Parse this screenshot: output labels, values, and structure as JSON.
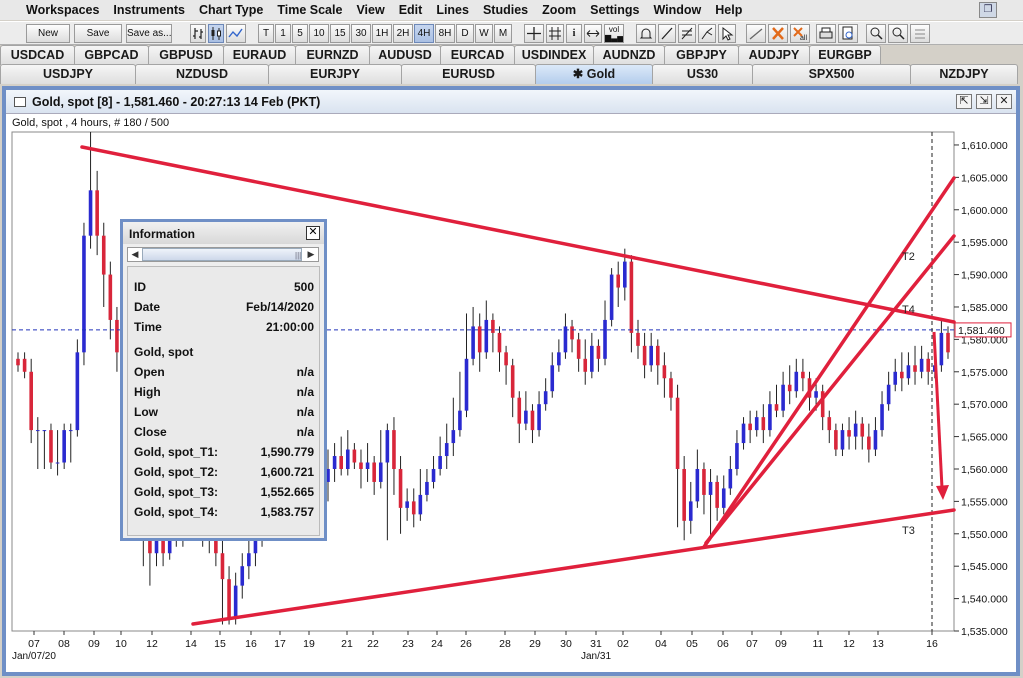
{
  "menu": [
    "Workspaces",
    "Instruments",
    "Chart Type",
    "Time Scale",
    "View",
    "Edit",
    "Lines",
    "Studies",
    "Zoom",
    "Settings",
    "Window",
    "Help"
  ],
  "toolbar": {
    "new_label": "New",
    "save_label": "Save",
    "save_as_label": "Save as...",
    "text_buttons": [
      "T",
      "1",
      "5",
      "10",
      "15",
      "30",
      "1H",
      "2H",
      "4H",
      "8H",
      "D",
      "W",
      "M"
    ],
    "selected_timeframe": "4H",
    "vol_label": "vol",
    "icons": [
      "bar-chart-icon",
      "candlestick-icon",
      "line-chart-icon",
      "crosshair-icon",
      "grid-icon",
      "info-icon",
      "arrows-icon",
      "alarm-bell-icon",
      "trendline-icon",
      "fib-icon",
      "pitchfork-icon",
      "cursor-icon",
      "line-tool-icon",
      "delete-icon",
      "delete-all-icon",
      "print-icon",
      "print-preview-icon",
      "zoom-in-icon",
      "zoom-out-icon",
      "zoom-reset-icon"
    ]
  },
  "tabs_row1": [
    "USDCAD",
    "GBPCAD",
    "GBPUSD",
    "EURAUD",
    "EURNZD",
    "AUDUSD",
    "EURCAD",
    "USDINDEX",
    "AUDNZD",
    "GBPJPY",
    "AUDJPY",
    "EURGBP"
  ],
  "tabs_row2": [
    "USDJPY",
    "NZDUSD",
    "EURJPY",
    "EURUSD",
    "✱ Gold",
    "US30",
    "SPX500",
    "NZDJPY"
  ],
  "active_tab": "✱ Gold",
  "window": {
    "title": "Gold, spot [8] - 1,581.460 - 20:27:13  14 Feb (PKT)",
    "subtitle": "Gold, spot , 4 hours, # 180 / 500",
    "controls": [
      "⇱",
      "⇲",
      "✕"
    ]
  },
  "info_panel": {
    "title": "Information",
    "close": "✕",
    "rows": [
      {
        "label": "ID",
        "value": "500"
      },
      {
        "label": "Date",
        "value": "Feb/14/2020"
      },
      {
        "label": "Time",
        "value": "21:00:00"
      },
      {
        "label": "Gold, spot",
        "value": ""
      },
      {
        "label": "Open",
        "value": "n/a"
      },
      {
        "label": "High",
        "value": "n/a"
      },
      {
        "label": "Low",
        "value": "n/a"
      },
      {
        "label": "Close",
        "value": "n/a"
      },
      {
        "label": "Gold, spot_T1:",
        "value": "1,590.779"
      },
      {
        "label": "Gold, spot_T2:",
        "value": "1,600.721"
      },
      {
        "label": "Gold, spot_T3:",
        "value": "1,552.665"
      },
      {
        "label": "Gold, spot_T4:",
        "value": "1,583.757"
      }
    ]
  },
  "chart_data": {
    "type": "candlestick",
    "symbol": "Gold, spot",
    "timeframe": "4 hours",
    "last_price": 1581.46,
    "last_price_label": "1,581.460",
    "ylim": [
      1535,
      1612
    ],
    "y_ticks": [
      "1,610.000",
      "1,605.000",
      "1,600.000",
      "1,595.000",
      "1,590.000",
      "1,585.000",
      "1,580.000",
      "1,575.000",
      "1,570.000",
      "1,565.000",
      "1,560.000",
      "1,555.000",
      "1,550.000",
      "1,545.000",
      "1,540.000",
      "1,535.000"
    ],
    "y_tick_values": [
      1610,
      1605,
      1600,
      1595,
      1590,
      1585,
      1580,
      1575,
      1570,
      1565,
      1560,
      1555,
      1550,
      1545,
      1540,
      1535
    ],
    "x_ticks": [
      "07",
      "08",
      "09",
      "10",
      "12",
      "14",
      "15",
      "16",
      "17",
      "19",
      "21",
      "22",
      "23",
      "24",
      "26",
      "28",
      "29",
      "30",
      "31",
      "02",
      "04",
      "05",
      "06",
      "07",
      "09",
      "11",
      "12",
      "13",
      "16"
    ],
    "x_start_label": "Jan/07/20",
    "x_mid_label": "Jan/31",
    "trendline_labels": [
      "T2",
      "T4",
      "T3"
    ],
    "colors": {
      "up": "#2a2ad0",
      "down": "#d8263a",
      "trendline": "#e0203c",
      "price_line": "#2233bb"
    },
    "candles": [
      [
        1577,
        1576,
        1578,
        1575
      ],
      [
        1577,
        1575,
        1578,
        1574
      ],
      [
        1575,
        1566,
        1577,
        1564
      ],
      [
        1566,
        1566,
        1568,
        1560
      ],
      [
        1566,
        1566,
        1566,
        1560
      ],
      [
        1566,
        1561,
        1567,
        1560
      ],
      [
        1561,
        1561,
        1566,
        1559
      ],
      [
        1561,
        1566,
        1567,
        1560
      ],
      [
        1566,
        1566,
        1567,
        1561
      ],
      [
        1566,
        1578,
        1580,
        1565
      ],
      [
        1578,
        1596,
        1598,
        1576
      ],
      [
        1596,
        1603,
        1612,
        1594
      ],
      [
        1603,
        1596,
        1606,
        1593
      ],
      [
        1596,
        1590,
        1598,
        1585
      ],
      [
        1590,
        1583,
        1592,
        1580
      ],
      [
        1583,
        1578,
        1585,
        1575
      ],
      [
        1578,
        1570,
        1581,
        1566
      ],
      [
        1570,
        1560,
        1572,
        1556
      ],
      [
        1560,
        1553,
        1563,
        1550
      ],
      [
        1553,
        1549,
        1556,
        1545
      ],
      [
        1549,
        1547,
        1556,
        1542
      ],
      [
        1547,
        1549,
        1554,
        1545
      ],
      [
        1549,
        1547,
        1552,
        1545
      ],
      [
        1547,
        1555,
        1557,
        1546
      ],
      [
        1555,
        1552,
        1557,
        1548
      ],
      [
        1552,
        1551,
        1556,
        1548
      ],
      [
        1551,
        1554,
        1556,
        1549
      ],
      [
        1554,
        1553,
        1556,
        1551
      ],
      [
        1553,
        1551,
        1555,
        1548
      ],
      [
        1551,
        1550,
        1554,
        1547
      ],
      [
        1550,
        1547,
        1552,
        1545
      ],
      [
        1547,
        1543,
        1549,
        1536
      ],
      [
        1543,
        1537,
        1545,
        1536
      ],
      [
        1537,
        1542,
        1544,
        1536
      ],
      [
        1542,
        1545,
        1547,
        1540
      ],
      [
        1545,
        1547,
        1549,
        1543
      ],
      [
        1547,
        1550,
        1552,
        1545
      ],
      [
        1550,
        1552,
        1555,
        1548
      ],
      [
        1552,
        1555,
        1558,
        1550
      ],
      [
        1555,
        1556,
        1560,
        1553
      ],
      [
        1556,
        1554,
        1558,
        1552
      ],
      [
        1554,
        1556,
        1559,
        1551
      ],
      [
        1556,
        1553,
        1558,
        1551
      ],
      [
        1553,
        1555,
        1557,
        1550
      ],
      [
        1555,
        1553,
        1556,
        1549
      ],
      [
        1553,
        1556,
        1558,
        1551
      ],
      [
        1556,
        1558,
        1561,
        1554
      ],
      [
        1558,
        1560,
        1563,
        1555
      ],
      [
        1560,
        1562,
        1564,
        1558
      ],
      [
        1562,
        1560,
        1565,
        1559
      ],
      [
        1560,
        1563,
        1566,
        1559
      ],
      [
        1563,
        1561,
        1564,
        1560
      ],
      [
        1561,
        1560,
        1563,
        1557
      ],
      [
        1560,
        1561,
        1564,
        1558
      ],
      [
        1561,
        1558,
        1562,
        1556
      ],
      [
        1558,
        1561,
        1566,
        1557
      ],
      [
        1561,
        1566,
        1567,
        1549
      ],
      [
        1566,
        1560,
        1568,
        1556
      ],
      [
        1560,
        1554,
        1562,
        1550
      ],
      [
        1554,
        1555,
        1557,
        1552
      ],
      [
        1555,
        1553,
        1557,
        1551
      ],
      [
        1553,
        1556,
        1560,
        1552
      ],
      [
        1556,
        1558,
        1560,
        1555
      ],
      [
        1558,
        1560,
        1562,
        1557
      ],
      [
        1560,
        1562,
        1565,
        1559
      ],
      [
        1562,
        1564,
        1567,
        1560
      ],
      [
        1564,
        1566,
        1571,
        1562
      ],
      [
        1566,
        1569,
        1575,
        1565
      ],
      [
        1569,
        1577,
        1584,
        1568
      ],
      [
        1577,
        1582,
        1585,
        1576
      ],
      [
        1582,
        1578,
        1584,
        1575
      ],
      [
        1578,
        1583,
        1586,
        1577
      ],
      [
        1583,
        1581,
        1584,
        1578
      ],
      [
        1581,
        1578,
        1582,
        1575
      ],
      [
        1578,
        1576,
        1579,
        1573
      ],
      [
        1576,
        1571,
        1577,
        1568
      ],
      [
        1571,
        1567,
        1572,
        1564
      ],
      [
        1567,
        1569,
        1572,
        1566
      ],
      [
        1569,
        1566,
        1570,
        1564
      ],
      [
        1566,
        1570,
        1572,
        1565
      ],
      [
        1570,
        1572,
        1574,
        1569
      ],
      [
        1572,
        1576,
        1578,
        1571
      ],
      [
        1576,
        1578,
        1580,
        1575
      ],
      [
        1578,
        1582,
        1584,
        1577
      ],
      [
        1582,
        1580,
        1583,
        1578
      ],
      [
        1580,
        1577,
        1581,
        1575
      ],
      [
        1577,
        1575,
        1580,
        1573
      ],
      [
        1575,
        1579,
        1581,
        1574
      ],
      [
        1579,
        1577,
        1580,
        1575
      ],
      [
        1577,
        1583,
        1586,
        1576
      ],
      [
        1583,
        1590,
        1591,
        1582
      ],
      [
        1590,
        1588,
        1592,
        1585
      ],
      [
        1588,
        1592,
        1594,
        1586
      ],
      [
        1592,
        1581,
        1593,
        1578
      ],
      [
        1581,
        1579,
        1583,
        1577
      ],
      [
        1579,
        1576,
        1581,
        1574
      ],
      [
        1576,
        1579,
        1581,
        1575
      ],
      [
        1579,
        1576,
        1580,
        1573
      ],
      [
        1576,
        1574,
        1578,
        1571
      ],
      [
        1574,
        1571,
        1575,
        1569
      ],
      [
        1571,
        1560,
        1573,
        1551
      ],
      [
        1560,
        1552,
        1562,
        1549
      ],
      [
        1552,
        1555,
        1558,
        1550
      ],
      [
        1555,
        1560,
        1563,
        1554
      ],
      [
        1560,
        1556,
        1561,
        1553
      ],
      [
        1556,
        1558,
        1560,
        1549
      ],
      [
        1558,
        1554,
        1559,
        1552
      ],
      [
        1554,
        1557,
        1559,
        1553
      ],
      [
        1557,
        1560,
        1562,
        1556
      ],
      [
        1560,
        1564,
        1566,
        1559
      ],
      [
        1564,
        1567,
        1568,
        1563
      ],
      [
        1567,
        1566,
        1569,
        1564
      ],
      [
        1566,
        1568,
        1569,
        1565
      ],
      [
        1568,
        1566,
        1570,
        1564
      ],
      [
        1566,
        1570,
        1572,
        1565
      ],
      [
        1570,
        1569,
        1573,
        1568
      ],
      [
        1569,
        1573,
        1575,
        1568
      ],
      [
        1573,
        1572,
        1576,
        1570
      ],
      [
        1572,
        1575,
        1577,
        1571
      ],
      [
        1575,
        1574,
        1577,
        1572
      ],
      [
        1574,
        1571,
        1575,
        1569
      ],
      [
        1571,
        1572,
        1574,
        1569
      ],
      [
        1572,
        1568,
        1573,
        1566
      ],
      [
        1568,
        1566,
        1569,
        1564
      ],
      [
        1566,
        1563,
        1567,
        1562
      ],
      [
        1563,
        1566,
        1567,
        1562
      ],
      [
        1566,
        1565,
        1568,
        1563
      ],
      [
        1565,
        1567,
        1569,
        1563
      ],
      [
        1567,
        1565,
        1568,
        1563
      ],
      [
        1565,
        1563,
        1567,
        1561
      ],
      [
        1563,
        1566,
        1568,
        1562
      ],
      [
        1566,
        1570,
        1572,
        1565
      ],
      [
        1570,
        1573,
        1575,
        1569
      ],
      [
        1573,
        1575,
        1577,
        1572
      ],
      [
        1575,
        1574,
        1578,
        1572
      ],
      [
        1574,
        1576,
        1578,
        1573
      ],
      [
        1576,
        1575,
        1579,
        1573
      ],
      [
        1575,
        1577,
        1579,
        1574
      ],
      [
        1577,
        1575,
        1578,
        1573
      ],
      [
        1575,
        1576,
        1579,
        1574
      ],
      [
        1576,
        1581,
        1583,
        1575
      ],
      [
        1581,
        1578,
        1582,
        1577
      ]
    ]
  }
}
